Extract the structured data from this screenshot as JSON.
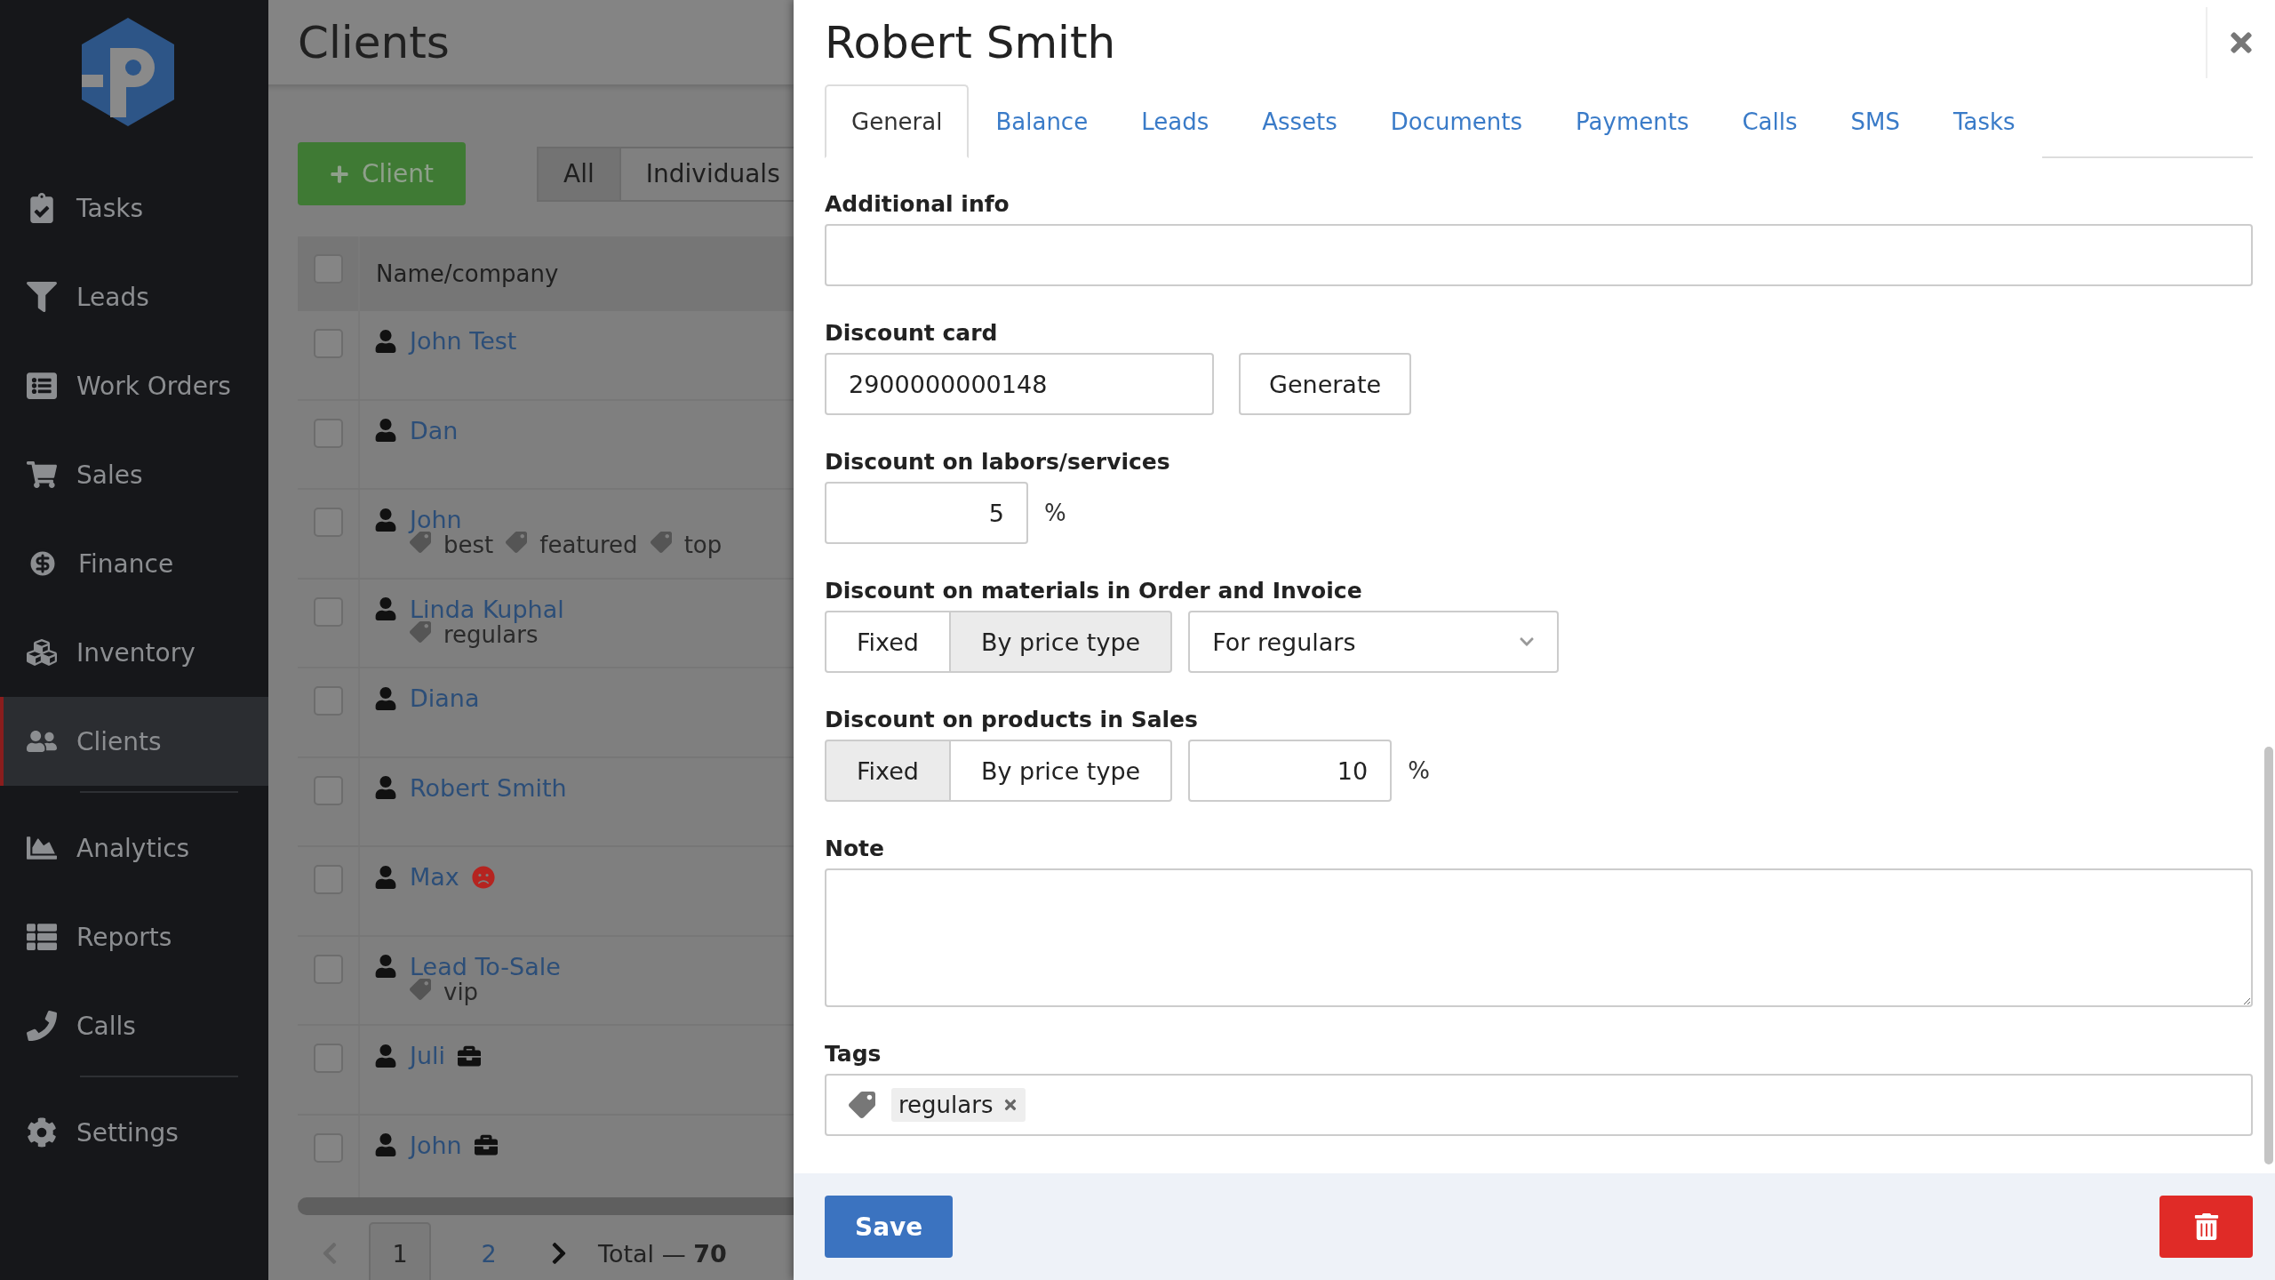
{
  "sidebar": {
    "groups": [
      [
        {
          "label": "Tasks",
          "selected": false
        },
        {
          "label": "Leads",
          "selected": false
        },
        {
          "label": "Work Orders",
          "selected": false
        },
        {
          "label": "Sales",
          "selected": false
        },
        {
          "label": "Finance",
          "selected": false
        },
        {
          "label": "Inventory",
          "selected": false
        },
        {
          "label": "Clients",
          "selected": true
        }
      ],
      [
        {
          "label": "Analytics",
          "selected": false
        },
        {
          "label": "Reports",
          "selected": false
        },
        {
          "label": "Calls",
          "selected": false
        }
      ],
      [
        {
          "label": "Settings",
          "selected": false
        }
      ]
    ]
  },
  "clients": {
    "title": "Clients",
    "add_button": "Client",
    "filters": [
      {
        "label": "All",
        "selected": true
      },
      {
        "label": "Individuals",
        "selected": false
      }
    ],
    "table": {
      "columns": [
        "Name/company"
      ],
      "header_checked": false,
      "rows": [
        {
          "name": "John Test",
          "checked": false,
          "tags": []
        },
        {
          "name": "Dan",
          "checked": false,
          "tags": []
        },
        {
          "name": "John",
          "checked": false,
          "tags": [
            "best",
            "featured",
            "top"
          ]
        },
        {
          "name": "Linda Kuphal",
          "checked": false,
          "tags": [
            "regulars"
          ]
        },
        {
          "name": "Diana",
          "checked": false,
          "tags": []
        },
        {
          "name": "Robert Smith",
          "checked": false,
          "tags": []
        },
        {
          "name": "Max",
          "checked": false,
          "tags": [],
          "unhappy": true
        },
        {
          "name": "Lead To-Sale",
          "checked": false,
          "tags": [
            "vip"
          ]
        },
        {
          "name": "Juli",
          "checked": false,
          "tags": [],
          "company": true
        },
        {
          "name": "John",
          "checked": false,
          "tags": [],
          "company": true
        }
      ]
    },
    "pagination": {
      "pages": [
        {
          "label": "1",
          "selected": true
        },
        {
          "label": "2",
          "selected": false
        }
      ],
      "total": "Total — **70**"
    }
  },
  "panel": {
    "title": "Robert Smith",
    "tabs": [
      {
        "label": "General",
        "selected": true
      },
      {
        "label": "Balance",
        "selected": false
      },
      {
        "label": "Leads",
        "selected": false
      },
      {
        "label": "Assets",
        "selected": false
      },
      {
        "label": "Documents",
        "selected": false
      },
      {
        "label": "Payments",
        "selected": false
      },
      {
        "label": "Calls",
        "selected": false
      },
      {
        "label": "SMS",
        "selected": false
      },
      {
        "label": "Tasks",
        "selected": false
      }
    ],
    "additional_info": {
      "label": "Additional info"
    },
    "discount_card": {
      "label": "Discount card",
      "value": "2900000000148",
      "button": "Generate"
    },
    "discount_labors": {
      "label": "Discount on labors/services",
      "value": "5",
      "unit": "%"
    },
    "discount_materials": {
      "label": "Discount on materials in Order and Invoice",
      "modes": [
        {
          "label": "Fixed",
          "selected": false
        },
        {
          "label": "By price type",
          "selected": true
        }
      ],
      "price_type": "For regulars"
    },
    "discount_products": {
      "label": "Discount on products in Sales",
      "modes": [
        {
          "label": "Fixed",
          "selected": true
        },
        {
          "label": "By price type",
          "selected": false
        }
      ],
      "value": "10",
      "unit": "%"
    },
    "note": {
      "label": "Note"
    },
    "tags": {
      "label": "Tags",
      "items": [
        "regulars"
      ]
    },
    "save_button": "Save"
  }
}
